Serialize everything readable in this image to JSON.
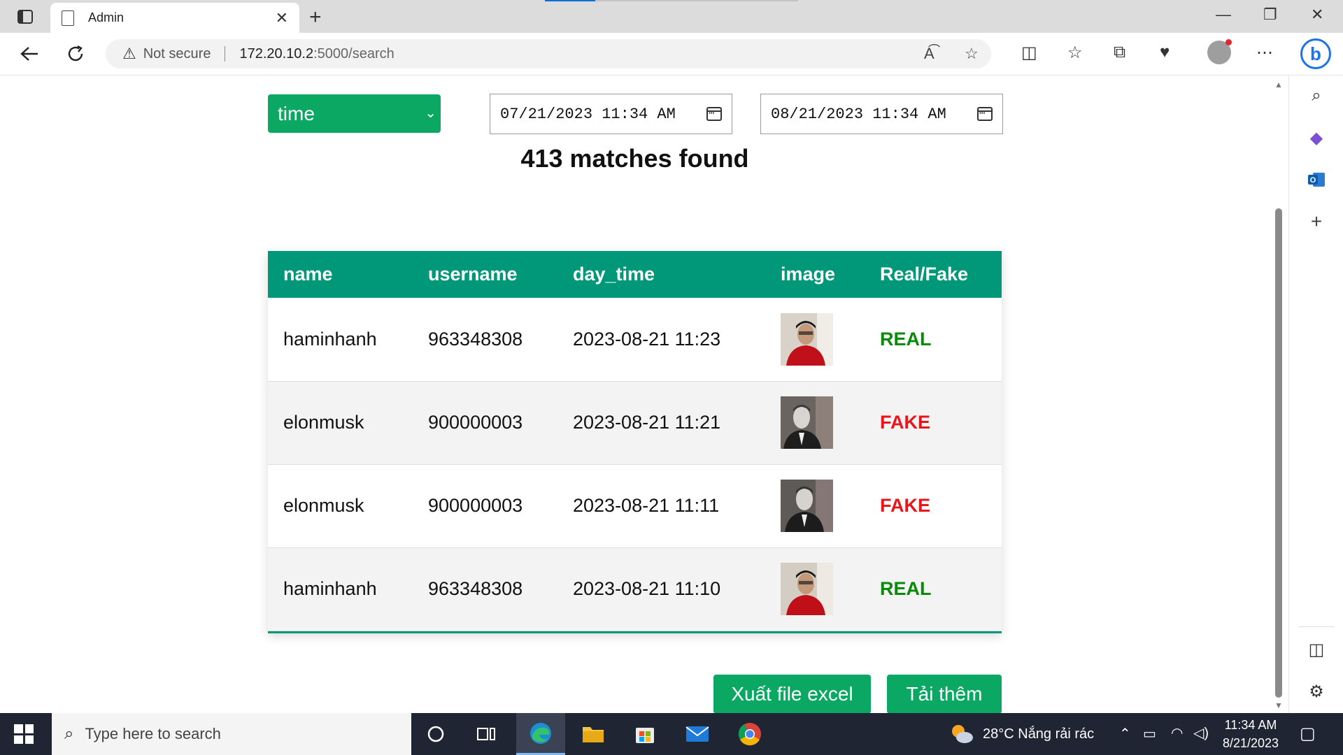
{
  "browser": {
    "tab_title": "Admin",
    "security_label": "Not secure",
    "url_host": "172.20.10.2",
    "url_path": ":5000/search"
  },
  "filter": {
    "field": "time",
    "from_datetime": "07/21/2023  11:34  AM",
    "to_datetime": "08/21/2023  11:34  AM"
  },
  "results": {
    "summary": "413 matches found",
    "columns": [
      "name",
      "username",
      "day_time",
      "image",
      "Real/Fake"
    ],
    "rows": [
      {
        "name": "haminhanh",
        "username": "963348308",
        "day_time": "2023-08-21 11:23",
        "status": "REAL",
        "status_color": "#0a8a0a",
        "image_icon": "person-photo-red-shirt"
      },
      {
        "name": "elonmusk",
        "username": "900000003",
        "day_time": "2023-08-21 11:21",
        "status": "FAKE",
        "status_color": "#e8161b",
        "image_icon": "person-photo-grayscale"
      },
      {
        "name": "elonmusk",
        "username": "900000003",
        "day_time": "2023-08-21 11:11",
        "status": "FAKE",
        "status_color": "#e8161b",
        "image_icon": "person-photo-grayscale"
      },
      {
        "name": "haminhanh",
        "username": "963348308",
        "day_time": "2023-08-21 11:10",
        "status": "REAL",
        "status_color": "#0a8a0a",
        "image_icon": "person-photo-red-shirt"
      }
    ]
  },
  "actions": {
    "export_label": "Xuất file excel",
    "load_more_label": "Tải thêm"
  },
  "taskbar": {
    "search_placeholder": "Type here to search",
    "weather": "28°C  Nắng rải rác",
    "time": "11:34 AM",
    "date": "8/21/2023"
  },
  "colors": {
    "accent": "#009879",
    "button_green": "#0aa862"
  }
}
